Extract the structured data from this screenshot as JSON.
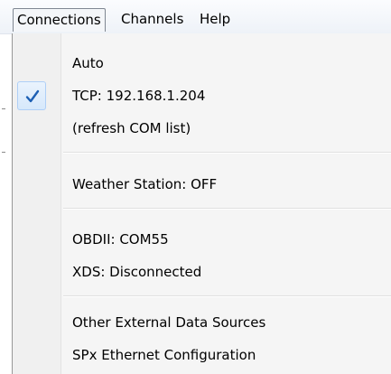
{
  "menubar": {
    "items": [
      {
        "label": "Connections"
      },
      {
        "label": "Channels"
      },
      {
        "label": "Help"
      }
    ]
  },
  "dropdown": {
    "groups": [
      [
        {
          "label": "Auto",
          "checked": false
        },
        {
          "label": "TCP: 192.168.1.204",
          "checked": true
        },
        {
          "label": "(refresh COM list)",
          "checked": false
        }
      ],
      [
        {
          "label": "Weather Station: OFF",
          "checked": false
        }
      ],
      [
        {
          "label": "OBDII: COM55",
          "checked": false
        },
        {
          "label": "XDS: Disconnected",
          "checked": false
        }
      ],
      [
        {
          "label": "Other External Data Sources",
          "checked": false
        },
        {
          "label": "SPx Ethernet Configuration",
          "checked": false
        }
      ]
    ]
  },
  "colors": {
    "check_mark": "#1c5fb4",
    "menu_background": "#f5f5f5",
    "gutter": "#f0f0f0"
  },
  "icons": {
    "check": "check-icon"
  }
}
